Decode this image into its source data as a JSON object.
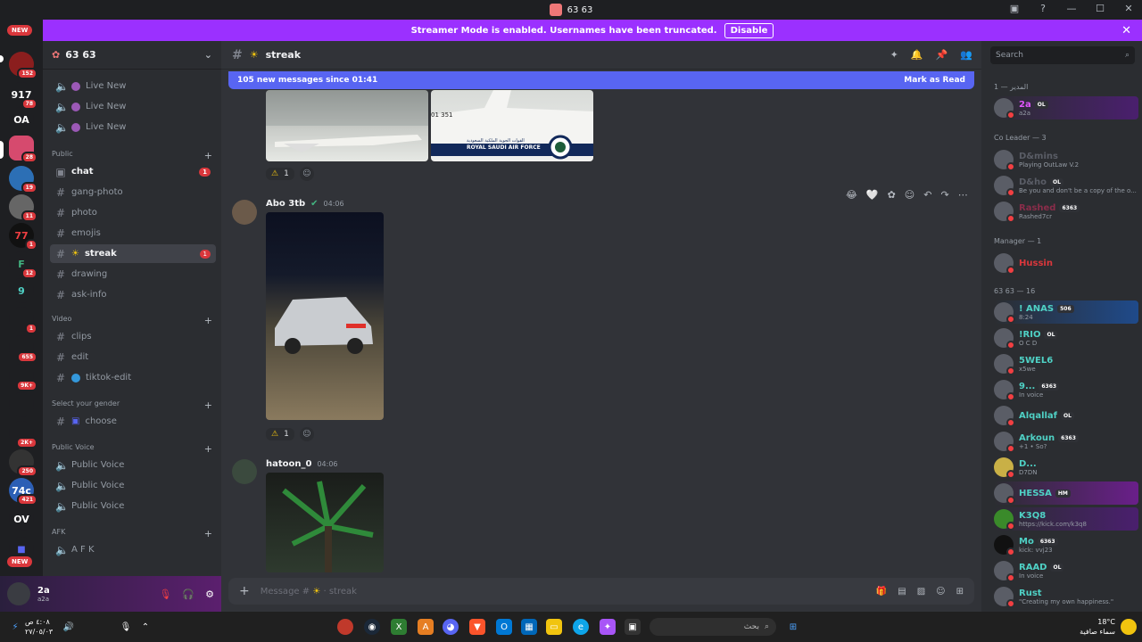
{
  "window": {
    "title": "63 63"
  },
  "banner": {
    "text": "Streamer Mode is enabled. Usernames have been truncated.",
    "disable": "Disable"
  },
  "servers": {
    "new_top": "NEW",
    "new_bottom": "NEW",
    "items": [
      {
        "label": "",
        "badge": "152"
      },
      {
        "label": "917",
        "badge": "78"
      },
      {
        "label": "OA",
        "badge": ""
      },
      {
        "label": "",
        "badge": "28"
      },
      {
        "label": "",
        "badge": "19"
      },
      {
        "label": "",
        "badge": "11"
      },
      {
        "label": "77",
        "badge": "1"
      },
      {
        "label": "F",
        "badge": "12"
      },
      {
        "label": "9",
        "badge": ""
      },
      {
        "label": "",
        "badge": "1"
      },
      {
        "label": "",
        "badge": "655"
      },
      {
        "label": "",
        "badge": "9K+"
      },
      {
        "label": "",
        "badge": ""
      },
      {
        "label": "",
        "badge": "2K+"
      },
      {
        "label": "",
        "badge": "250"
      },
      {
        "label": "74c",
        "badge": "421"
      },
      {
        "label": "OV",
        "badge": ""
      }
    ]
  },
  "guild": {
    "name": "63 63"
  },
  "channels": {
    "live": [
      "Live New",
      "Live New",
      "Live New"
    ],
    "public": {
      "title": "Public",
      "items": [
        {
          "name": "chat",
          "badge": "1"
        },
        {
          "name": "gang-photo"
        },
        {
          "name": "photo"
        },
        {
          "name": "emojis"
        },
        {
          "name": "streak",
          "badge": "1"
        },
        {
          "name": "drawing"
        },
        {
          "name": "ask-info"
        }
      ]
    },
    "video": {
      "title": "Video",
      "items": [
        "clips",
        "edit",
        "tiktok-edit"
      ]
    },
    "gender": {
      "title": "Select your gender",
      "items": [
        "choose"
      ]
    },
    "public_voice": {
      "title": "Public Voice",
      "items": [
        "Public Voice",
        "Public Voice",
        "Public Voice"
      ]
    },
    "afk": {
      "title": "AFK",
      "items": [
        "A F K"
      ]
    }
  },
  "user": {
    "name": "2a",
    "status": "a2a"
  },
  "chat": {
    "channel": "streak",
    "new_messages": "105 new messages since 01:41",
    "mark_read": "Mark as Read",
    "reaction_count_1": "1",
    "reaction_count_2": "1",
    "messages": [
      {
        "author": "Abo 3tb",
        "time": "04:06"
      },
      {
        "author": "hatoon_0",
        "time": "04:06"
      }
    ],
    "plane_text": "ROYAL SAUDI AIR FORCE",
    "plane_arabic": "القوات الجوية الملكية السعودية",
    "plane_code": "01 351",
    "composer_placeholder": "Message #",
    "composer_channel": "streak"
  },
  "members": {
    "search_placeholder": "Search",
    "groups": [
      {
        "title": "المدير — 1",
        "members": [
          {
            "name": "2a",
            "tag": "OL",
            "status": "a2a",
            "color": "#e056fd"
          }
        ]
      },
      {
        "title": "Co Leader — 3",
        "members": [
          {
            "name": "D&mins",
            "status": "Playing OutLaw V.2",
            "color": "#5a5d66"
          },
          {
            "name": "D&ho",
            "tag": "OL",
            "status": "Be you and don't be a copy of the o...",
            "color": "#5a5d66"
          },
          {
            "name": "Rashed",
            "tag": "6363",
            "status": "Rashed7cr",
            "color": "#8a2d4a"
          }
        ]
      },
      {
        "title": "Manager — 1",
        "members": [
          {
            "name": "Hussin",
            "status": "",
            "color": "#da373c"
          }
        ]
      },
      {
        "title": "63 63 — 16",
        "members": [
          {
            "name": "! ANAS",
            "tag": "506",
            "status": "8:24",
            "color": "#4fd1c5"
          },
          {
            "name": "!RIO",
            "tag": "OL",
            "status": "O C D",
            "color": "#4fd1c5"
          },
          {
            "name": "5WEL6",
            "status": "x5we",
            "color": "#4fd1c5"
          },
          {
            "name": "9...",
            "tag": "6363",
            "status": "In voice",
            "color": "#4fd1c5"
          },
          {
            "name": "Alqallaf",
            "tag": "OL",
            "status": "",
            "color": "#4fd1c5"
          },
          {
            "name": "Arkoun",
            "tag": "6363",
            "status": "+1 • So?",
            "color": "#4fd1c5"
          },
          {
            "name": "D...",
            "status": "D7DN",
            "color": "#4fd1c5"
          },
          {
            "name": "HESSA",
            "tag": "HM",
            "status": "",
            "color": "#4fd1c5"
          },
          {
            "name": "K3Q8",
            "status": "https://kick.com/k3q8",
            "color": "#4fd1c5"
          },
          {
            "name": "Mo",
            "tag": "6363",
            "status": "kick: vvj23",
            "color": "#4fd1c5"
          },
          {
            "name": "RAAD",
            "tag": "OL",
            "status": "In voice",
            "color": "#4fd1c5"
          },
          {
            "name": "Rust",
            "status": "\"Creating my own happiness.\"",
            "color": "#4fd1c5"
          }
        ]
      }
    ]
  },
  "taskbar": {
    "time": "٤:٠٨ ص",
    "date": "٢٧/٠٥/٠٣",
    "search": "بحث",
    "weather_temp": "18°C",
    "weather_desc": "سماء صافية"
  }
}
